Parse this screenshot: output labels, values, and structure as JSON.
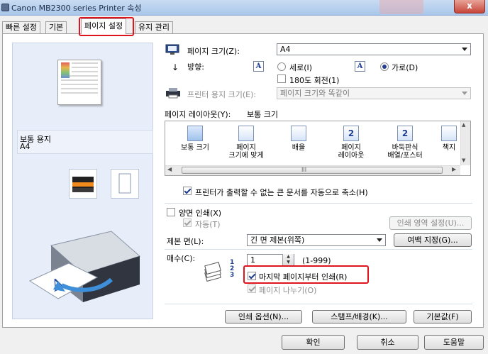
{
  "window": {
    "title": "Canon MB2300 series Printer 속성",
    "close_label": "x",
    "accent_red": "#e0141e"
  },
  "tabs": [
    {
      "label": "빠른 설정",
      "active": false
    },
    {
      "label": "기본",
      "active": false
    },
    {
      "label": "페이지 설정",
      "active": true
    },
    {
      "label": "유지 관리",
      "active": false
    }
  ],
  "preview": {
    "media_type": "보통 용지",
    "media_size": "A4"
  },
  "page_setup": {
    "page_size_label": "페이지 크기(Z):",
    "page_size_value": "A4",
    "orientation_label": "방향:",
    "orientation_options": [
      "세로(I)",
      "가로(D)"
    ],
    "orientation_selected": "가로(D)",
    "rotate_180_label": "180도 회전(1)",
    "printer_paper_size_label": "프린터 용지 크기(E):",
    "printer_paper_size_value": "페이지 크기와 똑같이",
    "page_layout_label": "페이지 레이아웃(Y):",
    "page_layout_value": "보통 크기",
    "layouts": [
      {
        "line1": "보통 크기",
        "line2": "",
        "selected": true
      },
      {
        "line1": "페이지",
        "line2": "크기에 맞게",
        "selected": false
      },
      {
        "line1": "배율",
        "line2": "",
        "selected": false
      },
      {
        "line1": "페이지",
        "line2": "레이아웃",
        "selected": false
      },
      {
        "line1": "바둑판식",
        "line2": "배열/포스터",
        "selected": false
      },
      {
        "line1": "책지",
        "line2": "",
        "selected": false
      }
    ],
    "layout_page_numbers": [
      "2",
      "2"
    ],
    "scroll_mark": "III",
    "auto_reduce_label": "프린터가 출력할 수 없는 큰 문서를 자동으로 축소(H)",
    "duplex_label": "양면 인쇄(X)",
    "duplex_auto_label": "자동(T)",
    "print_area_setup_label": "인쇄 영역 설정(U)...",
    "stapling_side_label": "제본 면(L):",
    "stapling_side_value": "긴 면 제본(위쪽)",
    "margin_setup_label": "여백 지정(G)...",
    "copies_label": "매수(C):",
    "copies_value": "1",
    "copies_range": "(1-999)",
    "print_from_last_label": "마지막 페이지부터 인쇄(R)",
    "collate_label": "페이지 나누기(O)",
    "copy_stack_numbers": [
      "1",
      "2",
      "3"
    ],
    "print_options_label": "인쇄 옵션(N)...",
    "stamp_background_label": "스탬프/배경(K)...",
    "defaults_label": "기본값(F)"
  },
  "footer": {
    "ok_label": "확인",
    "cancel_label": "취소",
    "help_label": "도움말"
  },
  "icons": {
    "page_size_icon": "monitor-page-icon",
    "orientation_icon": "down-arrow-icon",
    "printer_paper_icon": "printer-icon",
    "portrait_icon": "letter-a-icon",
    "landscape_icon": "letter-a-icon",
    "copies_icon": "paper-stack-icon"
  }
}
